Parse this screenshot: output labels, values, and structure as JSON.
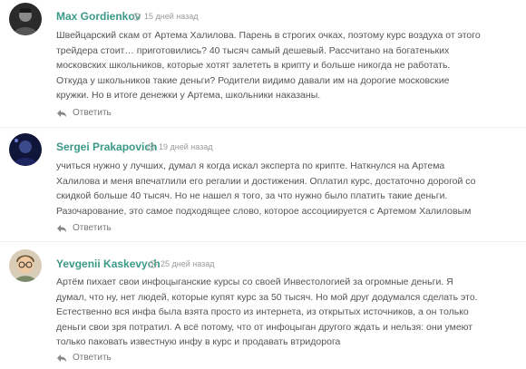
{
  "comments": [
    {
      "author": "Max Gordienkov",
      "time": "15 дней назад",
      "text": "Швейцарский скам от Артема Халилова. Парень в строгих очках, поэтому курс воздуха от этого трейдера стоит… приготовились? 40 тысяч самый дешевый. Рассчитано на богатеньких московских школьников, которые хотят залететь в крипту и больше никогда не работать. Откуда у школьников такие деньги? Родители видимо давали им на дорогие московские кружки. Но в итоге денежки у Артема, школьники наказаны.",
      "reply_label": "Ответить",
      "avatar_icon": "avatar-photo-dark"
    },
    {
      "author": "Sergei Prakapovich",
      "time": "19 дней назад",
      "text": "учиться нужно у лучших, думал я когда искал эксперта по крипте. Наткнулся на Артема Халилова и меня впечатлили его регалии и достижения. Оплатил курс, достаточно дорогой со скидкой больше 40 тысяч. Но не нашел я того, за что нужно было платить такие деньги. Разочарование, это самое подходящее слово, которое ассоциируется с Артемом Халиловым",
      "reply_label": "Ответить",
      "avatar_icon": "avatar-photo-night"
    },
    {
      "author": "Yevgenii Kaskevych",
      "time": "25 дней назад",
      "text": "Артём пихает свои инфоцыганские курсы со своей Инвестологией за огромные деньги. Я думал, что ну, нет людей, которые купят курс за 50 тысяч. Но мой друг додумался сделать это. Естественно вся инфа была взята просто из интернета, из открытых источников, а он только деньги свои зря потратил. А всё потому, что от инфоцыган другого ждать и нельзя: они умеют только паковать известную инфу в курс и продавать втридорога",
      "reply_label": "Ответить",
      "avatar_icon": "avatar-cartoon-man-glasses"
    }
  ],
  "colors": {
    "author": "#3b9a87",
    "text": "#555555",
    "meta": "#9a9a9a"
  }
}
